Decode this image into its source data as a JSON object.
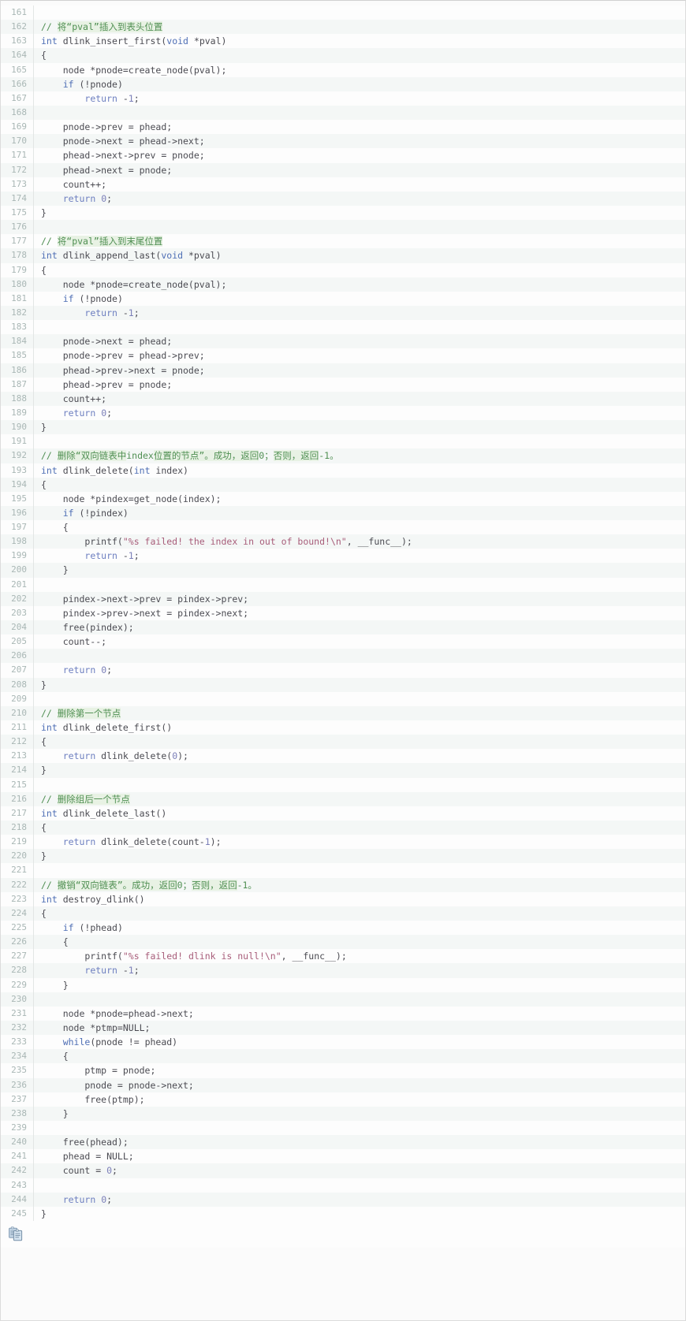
{
  "viewer": {
    "language": "c",
    "first_line": 161,
    "last_line": 245,
    "copy_button_title": "copy-to-clipboard",
    "colors": {
      "comment": "#4f8f52",
      "comment_cn_highlight": "#e8f2e4",
      "keyword": "#4f6fb5",
      "string": "#a85d7a",
      "number": "#7b7fb8",
      "text": "#4b4b52",
      "gutter": "#a9b7b5",
      "row_even": "#f4f7f6",
      "row_odd": "#fdfdfd",
      "border": "#dcdcdc"
    }
  },
  "lines": [
    {
      "n": "161",
      "tokens": []
    },
    {
      "n": "162",
      "tokens": [
        {
          "t": "// ",
          "c": "t-com"
        },
        {
          "t": "将“pval”插入到表头位置",
          "c": "t-comcn"
        }
      ]
    },
    {
      "n": "163",
      "tokens": [
        {
          "t": "int",
          "c": "t-kw"
        },
        {
          "t": " dlink_insert_first(",
          "c": "t-plain"
        },
        {
          "t": "void",
          "c": "t-kw"
        },
        {
          "t": " *pval)",
          "c": "t-plain"
        }
      ]
    },
    {
      "n": "164",
      "tokens": [
        {
          "t": "{",
          "c": "t-plain"
        }
      ]
    },
    {
      "n": "165",
      "tokens": [
        {
          "t": "    node *pnode=create_node(pval);",
          "c": "t-plain"
        }
      ]
    },
    {
      "n": "166",
      "tokens": [
        {
          "t": "    ",
          "c": "t-plain"
        },
        {
          "t": "if",
          "c": "t-kw"
        },
        {
          "t": " (!pnode)",
          "c": "t-plain"
        }
      ]
    },
    {
      "n": "167",
      "tokens": [
        {
          "t": "        ",
          "c": "t-plain"
        },
        {
          "t": "return",
          "c": "t-ret"
        },
        {
          "t": " -",
          "c": "t-plain"
        },
        {
          "t": "1",
          "c": "t-num"
        },
        {
          "t": ";",
          "c": "t-plain"
        }
      ]
    },
    {
      "n": "168",
      "tokens": []
    },
    {
      "n": "169",
      "tokens": [
        {
          "t": "    pnode->prev = phead;",
          "c": "t-plain"
        }
      ]
    },
    {
      "n": "170",
      "tokens": [
        {
          "t": "    pnode->next = phead->next;",
          "c": "t-plain"
        }
      ]
    },
    {
      "n": "171",
      "tokens": [
        {
          "t": "    phead->next->prev = pnode;",
          "c": "t-plain"
        }
      ]
    },
    {
      "n": "172",
      "tokens": [
        {
          "t": "    phead->next = pnode;",
          "c": "t-plain"
        }
      ]
    },
    {
      "n": "173",
      "tokens": [
        {
          "t": "    count++;",
          "c": "t-plain"
        }
      ]
    },
    {
      "n": "174",
      "tokens": [
        {
          "t": "    ",
          "c": "t-plain"
        },
        {
          "t": "return",
          "c": "t-ret"
        },
        {
          "t": " ",
          "c": "t-plain"
        },
        {
          "t": "0",
          "c": "t-num"
        },
        {
          "t": ";",
          "c": "t-plain"
        }
      ]
    },
    {
      "n": "175",
      "tokens": [
        {
          "t": "}",
          "c": "t-plain"
        }
      ]
    },
    {
      "n": "176",
      "tokens": []
    },
    {
      "n": "177",
      "tokens": [
        {
          "t": "// ",
          "c": "t-com"
        },
        {
          "t": "将“pval”插入到末尾位置",
          "c": "t-comcn"
        }
      ]
    },
    {
      "n": "178",
      "tokens": [
        {
          "t": "int",
          "c": "t-kw"
        },
        {
          "t": " dlink_append_last(",
          "c": "t-plain"
        },
        {
          "t": "void",
          "c": "t-kw"
        },
        {
          "t": " *pval)",
          "c": "t-plain"
        }
      ]
    },
    {
      "n": "179",
      "tokens": [
        {
          "t": "{",
          "c": "t-plain"
        }
      ]
    },
    {
      "n": "180",
      "tokens": [
        {
          "t": "    node *pnode=create_node(pval);",
          "c": "t-plain"
        }
      ]
    },
    {
      "n": "181",
      "tokens": [
        {
          "t": "    ",
          "c": "t-plain"
        },
        {
          "t": "if",
          "c": "t-kw"
        },
        {
          "t": " (!pnode)",
          "c": "t-plain"
        }
      ]
    },
    {
      "n": "182",
      "tokens": [
        {
          "t": "        ",
          "c": "t-plain"
        },
        {
          "t": "return",
          "c": "t-ret"
        },
        {
          "t": " -",
          "c": "t-plain"
        },
        {
          "t": "1",
          "c": "t-num"
        },
        {
          "t": ";",
          "c": "t-plain"
        }
      ]
    },
    {
      "n": "183",
      "tokens": []
    },
    {
      "n": "184",
      "tokens": [
        {
          "t": "    pnode->next = phead;",
          "c": "t-plain"
        }
      ]
    },
    {
      "n": "185",
      "tokens": [
        {
          "t": "    pnode->prev = phead->prev;",
          "c": "t-plain"
        }
      ]
    },
    {
      "n": "186",
      "tokens": [
        {
          "t": "    phead->prev->next = pnode;",
          "c": "t-plain"
        }
      ]
    },
    {
      "n": "187",
      "tokens": [
        {
          "t": "    phead->prev = pnode;",
          "c": "t-plain"
        }
      ]
    },
    {
      "n": "188",
      "tokens": [
        {
          "t": "    count++;",
          "c": "t-plain"
        }
      ]
    },
    {
      "n": "189",
      "tokens": [
        {
          "t": "    ",
          "c": "t-plain"
        },
        {
          "t": "return",
          "c": "t-ret"
        },
        {
          "t": " ",
          "c": "t-plain"
        },
        {
          "t": "0",
          "c": "t-num"
        },
        {
          "t": ";",
          "c": "t-plain"
        }
      ]
    },
    {
      "n": "190",
      "tokens": [
        {
          "t": "}",
          "c": "t-plain"
        }
      ]
    },
    {
      "n": "191",
      "tokens": []
    },
    {
      "n": "192",
      "tokens": [
        {
          "t": "// ",
          "c": "t-com"
        },
        {
          "t": "删除“双向链表中",
          "c": "t-comcn"
        },
        {
          "t": "index",
          "c": "t-com"
        },
        {
          "t": "位置的节点”。成功，",
          "c": "t-comcn"
        },
        {
          "t": "返回",
          "c": "t-comcn"
        },
        {
          "t": "0",
          "c": "t-com"
        },
        {
          "t": "；",
          "c": "t-com"
        },
        {
          "t": "否则，返回",
          "c": "t-comcn"
        },
        {
          "t": "-1。",
          "c": "t-com"
        }
      ]
    },
    {
      "n": "193",
      "tokens": [
        {
          "t": "int",
          "c": "t-kw"
        },
        {
          "t": " dlink_delete(",
          "c": "t-plain"
        },
        {
          "t": "int",
          "c": "t-kw"
        },
        {
          "t": " index)",
          "c": "t-plain"
        }
      ]
    },
    {
      "n": "194",
      "tokens": [
        {
          "t": "{",
          "c": "t-plain"
        }
      ]
    },
    {
      "n": "195",
      "tokens": [
        {
          "t": "    node *pindex=get_node(index);",
          "c": "t-plain"
        }
      ]
    },
    {
      "n": "196",
      "tokens": [
        {
          "t": "    ",
          "c": "t-plain"
        },
        {
          "t": "if",
          "c": "t-kw"
        },
        {
          "t": " (!pindex)",
          "c": "t-plain"
        }
      ]
    },
    {
      "n": "197",
      "tokens": [
        {
          "t": "    {",
          "c": "t-plain"
        }
      ]
    },
    {
      "n": "198",
      "tokens": [
        {
          "t": "        printf(",
          "c": "t-plain"
        },
        {
          "t": "\"%s failed! the index in out of bound!\\n\"",
          "c": "t-str"
        },
        {
          "t": ", __func__);",
          "c": "t-plain"
        }
      ]
    },
    {
      "n": "199",
      "tokens": [
        {
          "t": "        ",
          "c": "t-plain"
        },
        {
          "t": "return",
          "c": "t-ret"
        },
        {
          "t": " -",
          "c": "t-plain"
        },
        {
          "t": "1",
          "c": "t-num"
        },
        {
          "t": ";",
          "c": "t-plain"
        }
      ]
    },
    {
      "n": "200",
      "tokens": [
        {
          "t": "    }",
          "c": "t-plain"
        }
      ]
    },
    {
      "n": "201",
      "tokens": []
    },
    {
      "n": "202",
      "tokens": [
        {
          "t": "    pindex->next->prev = pindex->prev;",
          "c": "t-plain"
        }
      ]
    },
    {
      "n": "203",
      "tokens": [
        {
          "t": "    pindex->prev->next = pindex->next;",
          "c": "t-plain"
        }
      ]
    },
    {
      "n": "204",
      "tokens": [
        {
          "t": "    free(pindex);",
          "c": "t-plain"
        }
      ]
    },
    {
      "n": "205",
      "tokens": [
        {
          "t": "    count--;",
          "c": "t-plain"
        }
      ]
    },
    {
      "n": "206",
      "tokens": []
    },
    {
      "n": "207",
      "tokens": [
        {
          "t": "    ",
          "c": "t-plain"
        },
        {
          "t": "return",
          "c": "t-ret"
        },
        {
          "t": " ",
          "c": "t-plain"
        },
        {
          "t": "0",
          "c": "t-num"
        },
        {
          "t": ";",
          "c": "t-plain"
        }
      ]
    },
    {
      "n": "208",
      "tokens": [
        {
          "t": "}",
          "c": "t-plain"
        }
      ]
    },
    {
      "n": "209",
      "tokens": []
    },
    {
      "n": "210",
      "tokens": [
        {
          "t": "// ",
          "c": "t-com"
        },
        {
          "t": "删除第一个节点",
          "c": "t-comcn"
        }
      ]
    },
    {
      "n": "211",
      "tokens": [
        {
          "t": "int",
          "c": "t-kw"
        },
        {
          "t": " dlink_delete_first()",
          "c": "t-plain"
        }
      ]
    },
    {
      "n": "212",
      "tokens": [
        {
          "t": "{",
          "c": "t-plain"
        }
      ]
    },
    {
      "n": "213",
      "tokens": [
        {
          "t": "    ",
          "c": "t-plain"
        },
        {
          "t": "return",
          "c": "t-ret"
        },
        {
          "t": " dlink_delete(",
          "c": "t-plain"
        },
        {
          "t": "0",
          "c": "t-num"
        },
        {
          "t": ");",
          "c": "t-plain"
        }
      ]
    },
    {
      "n": "214",
      "tokens": [
        {
          "t": "}",
          "c": "t-plain"
        }
      ]
    },
    {
      "n": "215",
      "tokens": []
    },
    {
      "n": "216",
      "tokens": [
        {
          "t": "// ",
          "c": "t-com"
        },
        {
          "t": "删除组后一个节点",
          "c": "t-comcn"
        }
      ]
    },
    {
      "n": "217",
      "tokens": [
        {
          "t": "int",
          "c": "t-kw"
        },
        {
          "t": " dlink_delete_last()",
          "c": "t-plain"
        }
      ]
    },
    {
      "n": "218",
      "tokens": [
        {
          "t": "{",
          "c": "t-plain"
        }
      ]
    },
    {
      "n": "219",
      "tokens": [
        {
          "t": "    ",
          "c": "t-plain"
        },
        {
          "t": "return",
          "c": "t-ret"
        },
        {
          "t": " dlink_delete(count-",
          "c": "t-plain"
        },
        {
          "t": "1",
          "c": "t-num"
        },
        {
          "t": ");",
          "c": "t-plain"
        }
      ]
    },
    {
      "n": "220",
      "tokens": [
        {
          "t": "}",
          "c": "t-plain"
        }
      ]
    },
    {
      "n": "221",
      "tokens": []
    },
    {
      "n": "222",
      "tokens": [
        {
          "t": "// ",
          "c": "t-com"
        },
        {
          "t": "撤销“双向链表”。成功，",
          "c": "t-comcn"
        },
        {
          "t": "返回",
          "c": "t-comcn"
        },
        {
          "t": "0",
          "c": "t-com"
        },
        {
          "t": "；",
          "c": "t-com"
        },
        {
          "t": "否则，返回",
          "c": "t-comcn"
        },
        {
          "t": "-1。",
          "c": "t-com"
        }
      ]
    },
    {
      "n": "223",
      "tokens": [
        {
          "t": "int",
          "c": "t-kw"
        },
        {
          "t": " destroy_dlink()",
          "c": "t-plain"
        }
      ]
    },
    {
      "n": "224",
      "tokens": [
        {
          "t": "{",
          "c": "t-plain"
        }
      ]
    },
    {
      "n": "225",
      "tokens": [
        {
          "t": "    ",
          "c": "t-plain"
        },
        {
          "t": "if",
          "c": "t-kw"
        },
        {
          "t": " (!phead)",
          "c": "t-plain"
        }
      ]
    },
    {
      "n": "226",
      "tokens": [
        {
          "t": "    {",
          "c": "t-plain"
        }
      ]
    },
    {
      "n": "227",
      "tokens": [
        {
          "t": "        printf(",
          "c": "t-plain"
        },
        {
          "t": "\"%s failed! dlink is null!\\n\"",
          "c": "t-str"
        },
        {
          "t": ", __func__);",
          "c": "t-plain"
        }
      ]
    },
    {
      "n": "228",
      "tokens": [
        {
          "t": "        ",
          "c": "t-plain"
        },
        {
          "t": "return",
          "c": "t-ret"
        },
        {
          "t": " -",
          "c": "t-plain"
        },
        {
          "t": "1",
          "c": "t-num"
        },
        {
          "t": ";",
          "c": "t-plain"
        }
      ]
    },
    {
      "n": "229",
      "tokens": [
        {
          "t": "    }",
          "c": "t-plain"
        }
      ]
    },
    {
      "n": "230",
      "tokens": []
    },
    {
      "n": "231",
      "tokens": [
        {
          "t": "    node *pnode=phead->next;",
          "c": "t-plain"
        }
      ]
    },
    {
      "n": "232",
      "tokens": [
        {
          "t": "    node *ptmp=NULL;",
          "c": "t-plain"
        }
      ]
    },
    {
      "n": "233",
      "tokens": [
        {
          "t": "    ",
          "c": "t-plain"
        },
        {
          "t": "while",
          "c": "t-kw"
        },
        {
          "t": "(pnode != phead)",
          "c": "t-plain"
        }
      ]
    },
    {
      "n": "234",
      "tokens": [
        {
          "t": "    {",
          "c": "t-plain"
        }
      ]
    },
    {
      "n": "235",
      "tokens": [
        {
          "t": "        ptmp = pnode;",
          "c": "t-plain"
        }
      ]
    },
    {
      "n": "236",
      "tokens": [
        {
          "t": "        pnode = pnode->next;",
          "c": "t-plain"
        }
      ]
    },
    {
      "n": "237",
      "tokens": [
        {
          "t": "        free(ptmp);",
          "c": "t-plain"
        }
      ]
    },
    {
      "n": "238",
      "tokens": [
        {
          "t": "    }",
          "c": "t-plain"
        }
      ]
    },
    {
      "n": "239",
      "tokens": []
    },
    {
      "n": "240",
      "tokens": [
        {
          "t": "    free(phead);",
          "c": "t-plain"
        }
      ]
    },
    {
      "n": "241",
      "tokens": [
        {
          "t": "    phead = NULL;",
          "c": "t-plain"
        }
      ]
    },
    {
      "n": "242",
      "tokens": [
        {
          "t": "    count = ",
          "c": "t-plain"
        },
        {
          "t": "0",
          "c": "t-num"
        },
        {
          "t": ";",
          "c": "t-plain"
        }
      ]
    },
    {
      "n": "243",
      "tokens": []
    },
    {
      "n": "244",
      "tokens": [
        {
          "t": "    ",
          "c": "t-plain"
        },
        {
          "t": "return",
          "c": "t-ret"
        },
        {
          "t": " ",
          "c": "t-plain"
        },
        {
          "t": "0",
          "c": "t-num"
        },
        {
          "t": ";",
          "c": "t-plain"
        }
      ]
    },
    {
      "n": "245",
      "tokens": [
        {
          "t": "}",
          "c": "t-plain"
        }
      ]
    }
  ]
}
